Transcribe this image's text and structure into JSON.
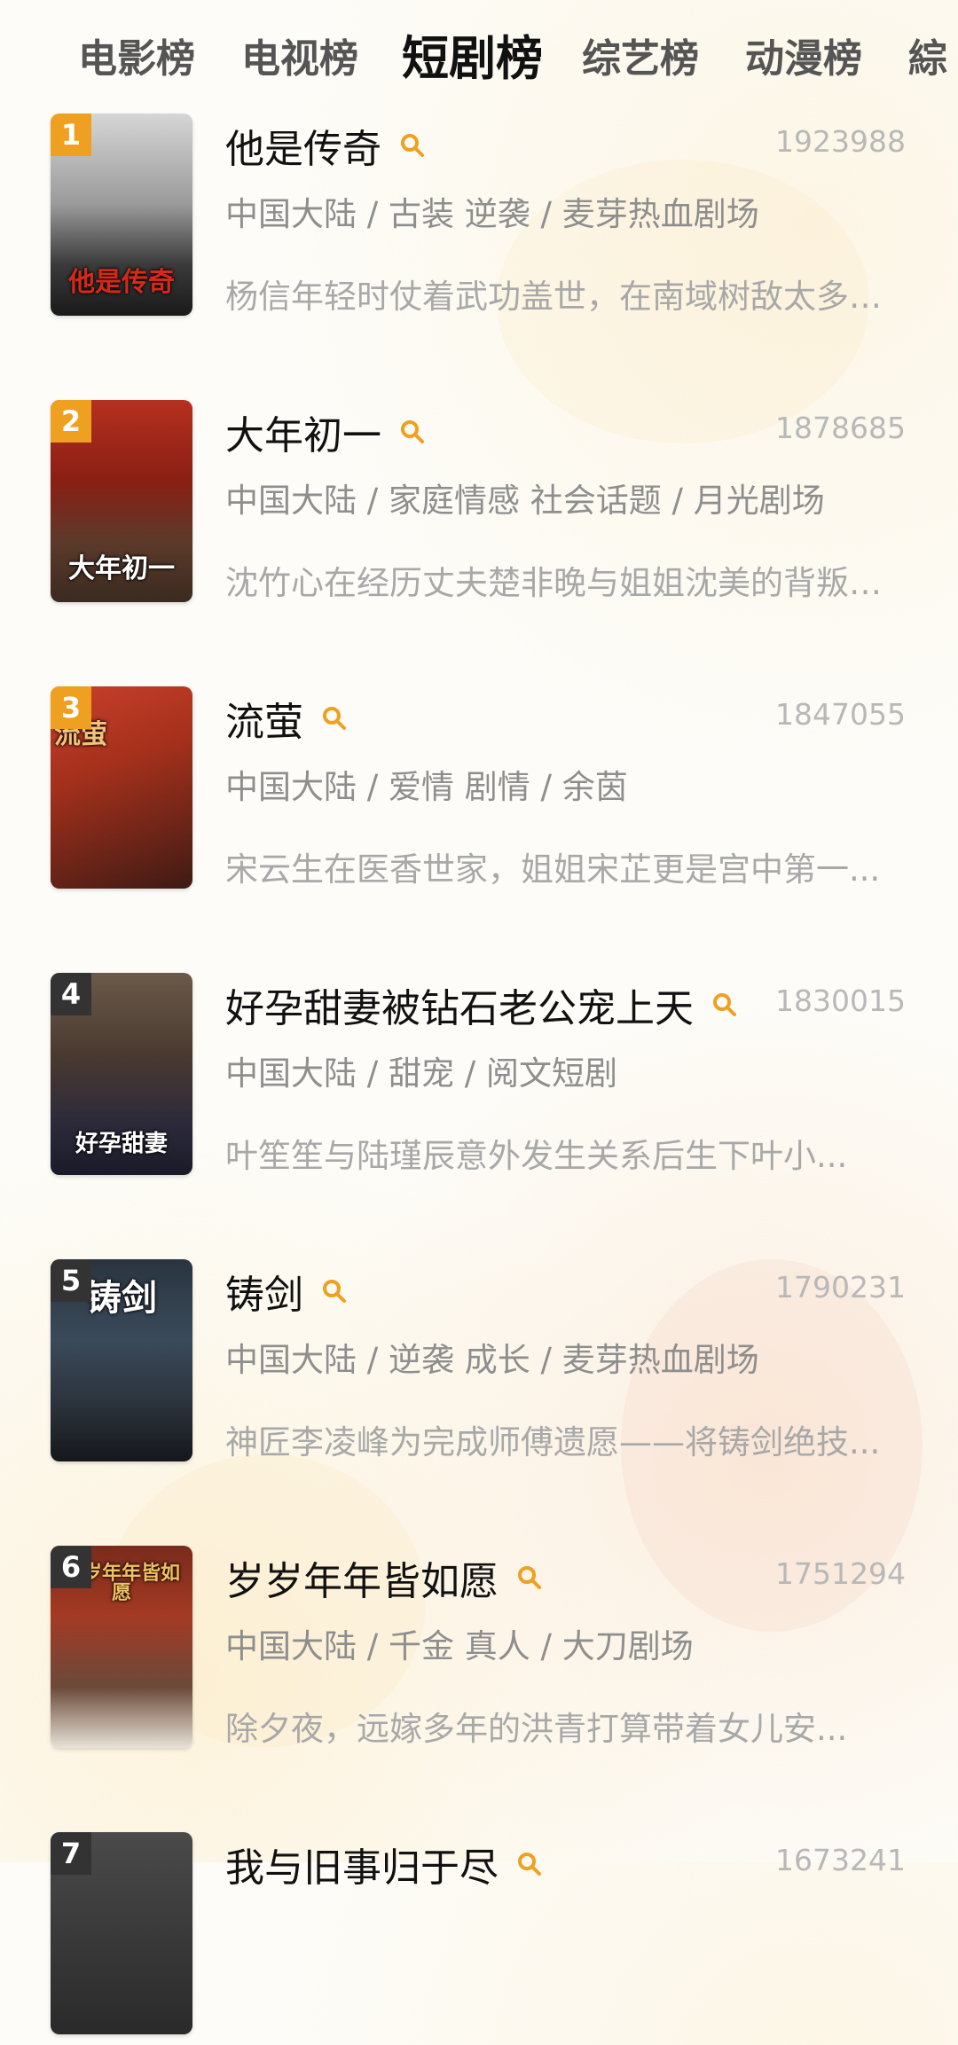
{
  "tabs": [
    {
      "label": "电影榜"
    },
    {
      "label": "电视榜"
    },
    {
      "label": "短剧榜"
    },
    {
      "label": "综艺榜"
    },
    {
      "label": "动漫榜"
    },
    {
      "label": "綜"
    }
  ],
  "active_tab": "短剧榜",
  "items": [
    {
      "rank": "1",
      "title": "他是传奇",
      "score": "1923988",
      "meta": "中国大陆 / 古装 逆袭 / 麦芽热血剧场",
      "desc": "杨信年轻时仗着武功盖世，在南域树敌太多，...",
      "poster_text": "他是传奇"
    },
    {
      "rank": "2",
      "title": "大年初一",
      "score": "1878685",
      "meta": "中国大陆 / 家庭情感 社会话题 / 月光剧场",
      "desc": "沈竹心在经历丈夫楚非晚与姐姐沈美的背叛后...",
      "poster_text": "大年初一"
    },
    {
      "rank": "3",
      "title": "流萤",
      "score": "1847055",
      "meta": "中国大陆 / 爱情 剧情 / 余茵",
      "desc": "宋云生在医香世家，姐姐宋芷更是宫中第一...",
      "poster_text": "流萤"
    },
    {
      "rank": "4",
      "title": "好孕甜妻被钻石老公宠上天",
      "score": "1830015",
      "meta": "中国大陆 / 甜宠 / 阅文短剧",
      "desc": "叶笙笙与陆瑾辰意外发生关系后生下叶小...",
      "poster_text": "好孕甜妻"
    },
    {
      "rank": "5",
      "title": "铸剑",
      "score": "1790231",
      "meta": "中国大陆 / 逆袭 成长 / 麦芽热血剧场",
      "desc": "神匠李凌峰为完成师傅遗愿——将铸剑绝技...",
      "poster_text": "铸剑"
    },
    {
      "rank": "6",
      "title": "岁岁年年皆如愿",
      "score": "1751294",
      "meta": "中国大陆 / 千金 真人 / 大刀剧场",
      "desc": "除夕夜，远嫁多年的洪青打算带着女儿安...",
      "poster_text": "岁岁年年皆如愿"
    },
    {
      "rank": "7",
      "title": "我与旧事归于尽",
      "score": "1673241",
      "meta": "",
      "desc": "",
      "poster_text": ""
    }
  ],
  "colors": {
    "gold_badge": "#f0a020",
    "dark_badge": "#333333",
    "search_icon": "#f0a020"
  }
}
